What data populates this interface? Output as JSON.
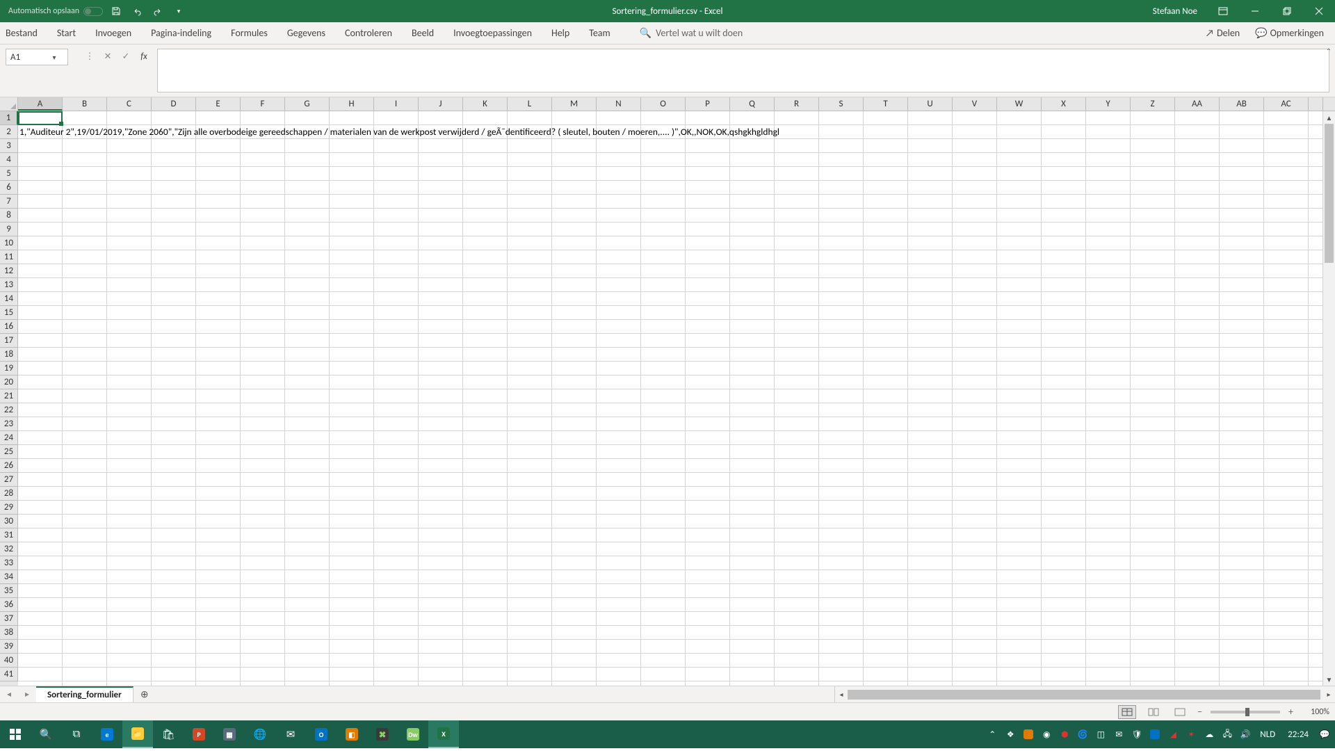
{
  "titlebar": {
    "autosave_label": "Automatisch opslaan",
    "document_title": "Sortering_formulier.csv  -  Excel",
    "username": "Stefaan Noe"
  },
  "ribbon": {
    "tabs": [
      "Bestand",
      "Start",
      "Invoegen",
      "Pagina-indeling",
      "Formules",
      "Gegevens",
      "Controleren",
      "Beeld",
      "Invoegtoepassingen",
      "Help",
      "Team"
    ],
    "search_placeholder": "Vertel wat u wilt doen",
    "share": "Delen",
    "comments": "Opmerkingen"
  },
  "namebox": {
    "value": "A1"
  },
  "columns": [
    "A",
    "B",
    "C",
    "D",
    "E",
    "F",
    "G",
    "H",
    "I",
    "J",
    "K",
    "L",
    "M",
    "N",
    "O",
    "P",
    "Q",
    "R",
    "S",
    "T",
    "U",
    "V",
    "W",
    "X",
    "Y",
    "Z",
    "AA",
    "AB",
    "AC"
  ],
  "rows": {
    "count": 41,
    "active": 1,
    "data": {
      "2": "1,\"Auditeur 2\",19/01/2019,\"Zone 2060\",\"Zijn alle overbodeige gereedschappen / materialen van de werkpost verwijderd / geÃ¯dentificeerd? ( sleutel, bouten / moeren,.... )\",OK,,NOK,OK,qshgkhgldhgl"
    }
  },
  "sheet": {
    "name": "Sortering_formulier"
  },
  "statusbar": {
    "zoom": "100%"
  },
  "taskbar": {
    "lang": "NLD",
    "time": "22:24"
  }
}
